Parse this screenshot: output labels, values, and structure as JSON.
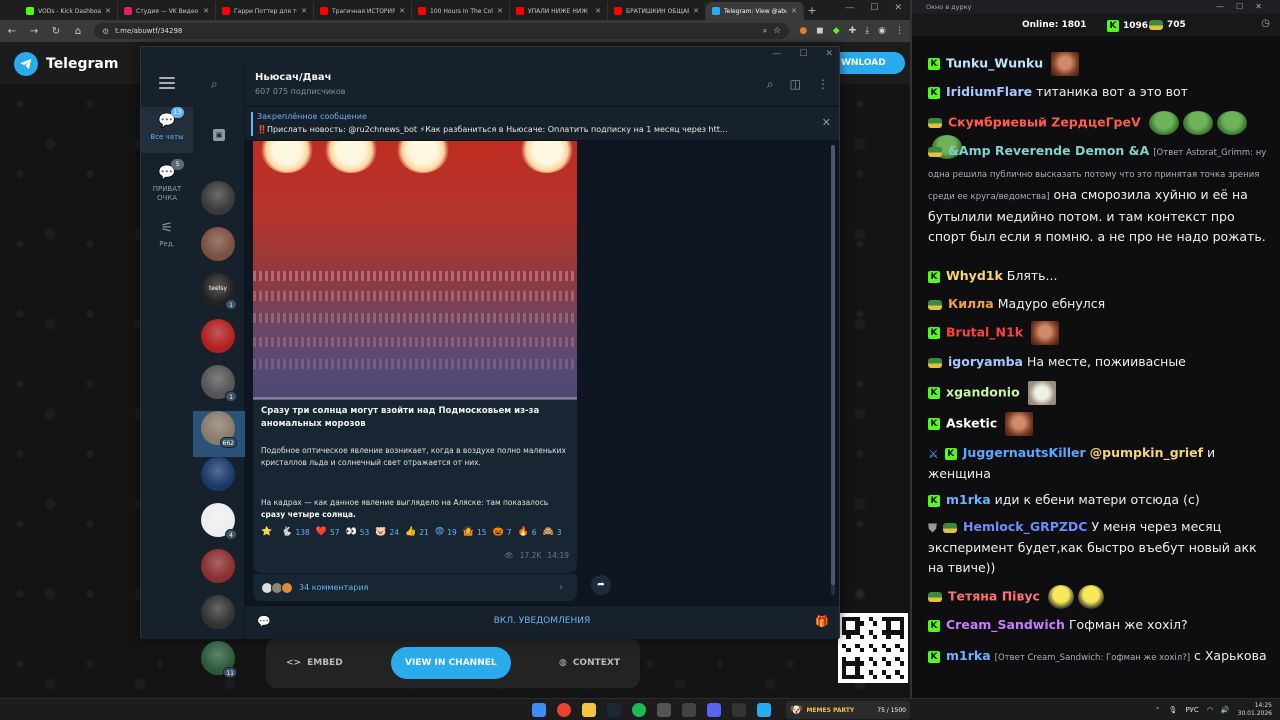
{
  "browser": {
    "tabs": [
      {
        "label": "VODs - Kick Dashboard",
        "color": "#53fc18",
        "active": false
      },
      {
        "label": "Студия — VK Видео Live",
        "color": "#e0245e",
        "active": false
      },
      {
        "label": "Гарри Поттер для тех",
        "color": "#ff0000",
        "active": false
      },
      {
        "label": "Трагичная ИСТОРИЯ",
        "color": "#ff0000",
        "active": false
      },
      {
        "label": "100 Hours In The Cold",
        "color": "#ff0000",
        "active": false
      },
      {
        "label": "УПАЛИ НИЖЕ НИЖ",
        "color": "#ff0000",
        "active": false
      },
      {
        "label": "БРАТИШКИН ОБЩАЕ",
        "color": "#ff0000",
        "active": false
      },
      {
        "label": "Telegram: View @abu",
        "color": "#2aabee",
        "active": true
      }
    ],
    "url": "t.me/abuwtf/34298",
    "page": {
      "brand": "Telegram",
      "download_label": "WNLOAD",
      "embed_label": "EMBED",
      "view_label": "VIEW IN CHANNEL",
      "context_label": "CONTEXT"
    }
  },
  "telegram": {
    "folders": [
      {
        "label": "Все чаты",
        "badge": "13"
      },
      {
        "label": "ПРИВАТ ОЧКА",
        "badge": "5"
      },
      {
        "label": "Ред.",
        "badge": ""
      }
    ],
    "chat_avatars": [
      {
        "badge": "",
        "color": "#3a3a3a"
      },
      {
        "badge": "",
        "color": "#7a5040"
      },
      {
        "badge": "1",
        "label": "teelsy",
        "color": "#222"
      },
      {
        "badge": "",
        "color": "#b02020"
      },
      {
        "badge": "1",
        "color": "#555"
      },
      {
        "badge": "662",
        "color": "#8a7a6a"
      },
      {
        "badge": "",
        "color": "#1a3a6a"
      },
      {
        "badge": "4",
        "color": "#eee"
      },
      {
        "badge": "",
        "color": "#8a3030"
      },
      {
        "badge": "",
        "color": "#333"
      },
      {
        "badge": "11",
        "color": "#2a5a3a"
      }
    ],
    "channel": {
      "name": "Ньюсач/Двач",
      "subscribers": "607 075 подписчиков"
    },
    "pinned": {
      "title": "Закреплённое сообщение",
      "text": "‼️Прислать новость: @ru2chnews_bot ⚡Как разбаниться в Ньюсаче: Оплатить подписку на 1 месяц через htt..."
    },
    "message": {
      "title": "Сразу три солнца могут взойти над Подмосковьем из-за аномальных морозов",
      "p1": "Подобное оптическое явление возникает, когда в воздухе полно маленьких кристаллов льда и солнечный свет отражается от них.",
      "p2_start": "На кадрах — как данное явление выглядело на Аляске: там показалось ",
      "p2_bold": "сразу четыре солнца.",
      "video_progress": 0.0,
      "reactions": [
        {
          "emoji": "⭐",
          "count": ""
        },
        {
          "emoji": "🐇",
          "count": "138"
        },
        {
          "emoji": "❤️",
          "count": "57"
        },
        {
          "emoji": "👀",
          "count": "53"
        },
        {
          "emoji": "🐷",
          "count": "24"
        },
        {
          "emoji": "👍",
          "count": "21"
        },
        {
          "emoji": "😨",
          "count": "19"
        },
        {
          "emoji": "🤷",
          "count": "15"
        },
        {
          "emoji": "🎃",
          "count": "7"
        },
        {
          "emoji": "🔥",
          "count": "6"
        },
        {
          "emoji": "🙈",
          "count": "3"
        }
      ],
      "views": "17.2K",
      "time": "14:19",
      "comments": "34 комментария"
    },
    "footer_label": "ВКЛ. УВЕДОМЛЕНИЯ"
  },
  "stream_chat": {
    "window_title": "Окно в дурку",
    "online_label": "Online:",
    "online_count": "1801",
    "k_count": "1096",
    "v_count": "705",
    "messages": [
      {
        "user": "Tunku_Wunku",
        "color": "#bde4ff",
        "badge": "k",
        "text": "",
        "emote": "face"
      },
      {
        "user": "IridiumFlare",
        "color": "#a6c8ff",
        "badge": "k",
        "text": "титаника вот а это вот"
      },
      {
        "user": "Скумбриевый ZердцеГреV",
        "color": "#ff5b4f",
        "badge": "pepe",
        "text": "",
        "emote": "pepe4"
      },
      {
        "user": "&Amp Reverende Demon &A",
        "color": "#7fd1c9",
        "badge": "pepe",
        "reply": "[Ответ Astorat_Grimm: ну одна решила публично высказать потому что это принятая точка зрения среди ее круга/ведомства]",
        "text": "она сморозила хуйню и её на бутылили медийно потом. и там контекст про спорт был если я помню. а не про не надо рожать."
      },
      {
        "user": "Whyd1k",
        "color": "#f5d76e",
        "badge": "k",
        "text": "Блять..."
      },
      {
        "user": "Килла",
        "color": "#f0a23a",
        "badge": "pepe",
        "text": "Мадуро ебнулся"
      },
      {
        "user": "Brutal_N1k",
        "color": "#ff4040",
        "badge": "k",
        "text": "",
        "emote": "face"
      },
      {
        "user": "igoryamba",
        "color": "#a6c8ff",
        "badge": "pepe",
        "text": "На месте, пожиивасные"
      },
      {
        "user": "xgandonio",
        "color": "#c8f5a0",
        "badge": "k",
        "text": "",
        "emote": "cat"
      },
      {
        "user": "Asketic",
        "color": "#ffffff",
        "badge": "k",
        "text": "",
        "emote": "face"
      },
      {
        "user": "JuggernautsKiller",
        "color": "#5aa8ff",
        "badge": "k2",
        "text": "@pumpkin_grief и женщина",
        "mention": "@pumpkin_grief"
      },
      {
        "user": "m1rka",
        "color": "#6fb0ff",
        "badge": "k",
        "text": "иди к ебени матери отсюда (с)"
      },
      {
        "user": "Hemlock_GRPZDC",
        "color": "#6f8cff",
        "badge": "pepe2",
        "text": "У меня через месяц эксперимент будет,как быстро въебут новый акк на твиче))"
      },
      {
        "user": "Тетяна Півус",
        "color": "#ff7070",
        "badge": "pepe",
        "text": "",
        "emote": "ball"
      },
      {
        "user": "Cream_Sandwich",
        "color": "#c97cff",
        "badge": "k",
        "text": "Гофман же хохіл?"
      },
      {
        "user": "m1rka",
        "color": "#6fb0ff",
        "badge": "k",
        "reply": "[Ответ Cream_Sandwich: Гофман же хохіл?]",
        "text": "с Харькова"
      }
    ]
  },
  "taskbar": {
    "widget_label": "MEMES PARTY",
    "widget_count": "75 / 1500",
    "lang": "РУС",
    "time": "14:25",
    "date": "30.01.2026"
  }
}
